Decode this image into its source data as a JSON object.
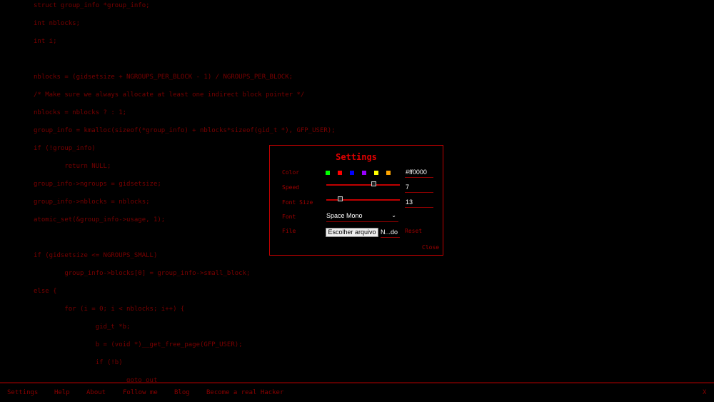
{
  "code_lines": [
    "struct group_info *group_info;",
    "int nblocks;",
    "int i;",
    "",
    "nblocks = (gidsetsize + NGROUPS_PER_BLOCK - 1) / NGROUPS_PER_BLOCK;",
    "/* Make sure we always allocate at least one indirect block pointer */",
    "nblocks = nblocks ? : 1;",
    "group_info = kmalloc(sizeof(*group_info) + nblocks*sizeof(gid_t *), GFP_USER);",
    "if (!group_info)",
    "        return NULL;",
    "group_info->ngroups = gidsetsize;",
    "group_info->nblocks = nblocks;",
    "atomic_set(&group_info->usage, 1);",
    "",
    "if (gidsetsize <= NGROUPS_SMALL)",
    "        group_info->blocks[0] = group_info->small_block;",
    "else {",
    "        for (i = 0; i < nblocks; i++) {",
    "                gid_t *b;",
    "                b = (void *)__get_free_page(GFP_USER);",
    "                if (!b)",
    "                        goto out"
  ],
  "settings": {
    "title": "Settings",
    "color_label": "Color",
    "color_swatches": [
      "#00ff00",
      "#ff0000",
      "#0000ff",
      "#9900ff",
      "#ffff00",
      "#ffa500"
    ],
    "color_value": "#ff0000",
    "speed_label": "Speed",
    "speed_value": "7",
    "speed_fraction": 0.66,
    "font_size_label": "Font Size",
    "font_size_value": "13",
    "font_size_fraction": 0.17,
    "font_label": "Font",
    "font_value": "Space Mono",
    "file_label": "File",
    "file_button": "Escolher arquivo",
    "file_name": "N...do",
    "reset_label": "Reset",
    "close_label": "Close"
  },
  "footer": {
    "items": [
      "Settings",
      "Help",
      "About",
      "Follow me",
      "Blog",
      "Become a real Hacker"
    ],
    "close": "X"
  },
  "colors": {
    "accent": "#c00000",
    "background": "#000000"
  }
}
